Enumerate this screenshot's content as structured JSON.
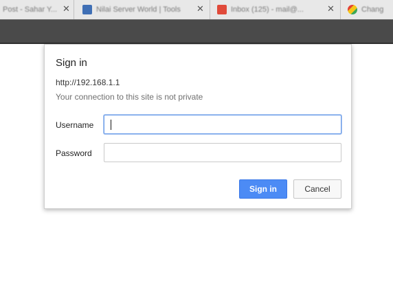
{
  "browser": {
    "tabs": [
      {
        "title": "Post - Sahar Y..."
      },
      {
        "title": "Nilai Server World | Tools"
      },
      {
        "title": "Inbox (125) - mail@..."
      },
      {
        "title": "Chang"
      }
    ]
  },
  "dialog": {
    "title": "Sign in",
    "url": "http://192.168.1.1",
    "warning": "Your connection to this site is not private",
    "username_label": "Username",
    "username_value": "",
    "password_label": "Password",
    "password_value": "",
    "sign_in_label": "Sign in",
    "cancel_label": "Cancel"
  },
  "colors": {
    "primary": "#4c8bf5",
    "toolbar": "#4a4a4a",
    "focus_border": "#6d9eea"
  }
}
